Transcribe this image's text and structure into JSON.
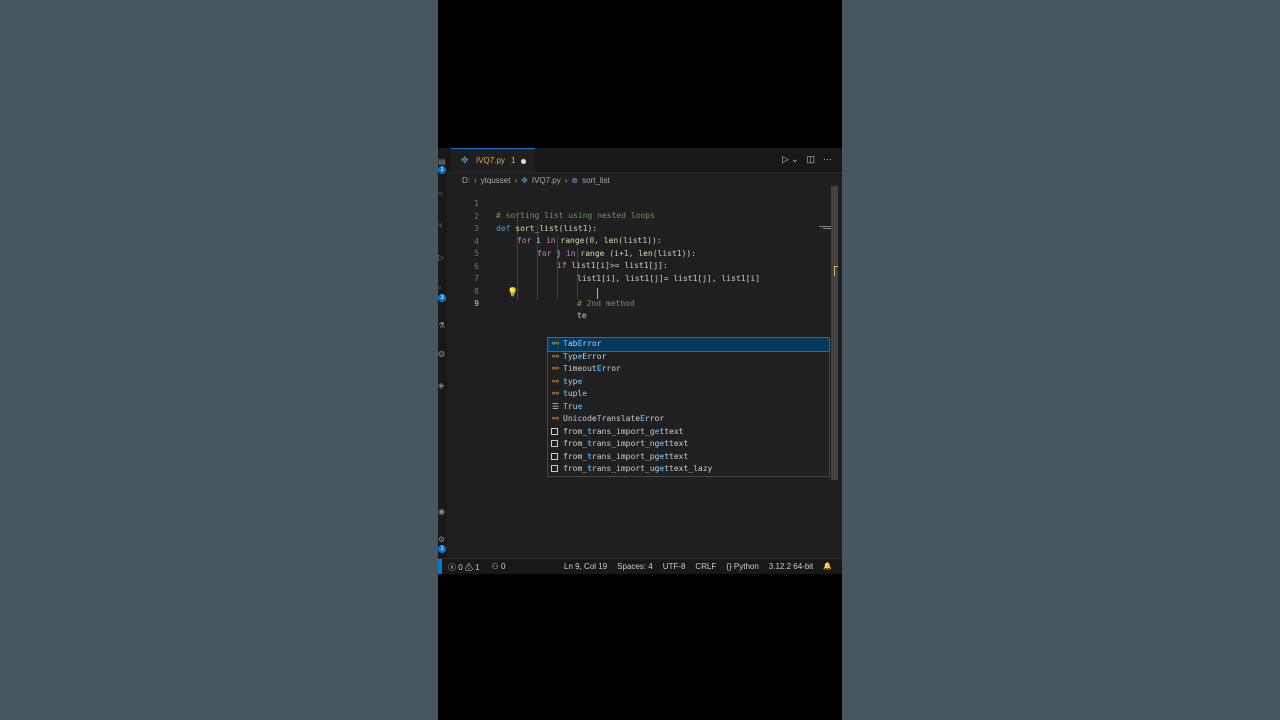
{
  "tab": {
    "filename": "IVQ7.py",
    "problems": "1",
    "file_icon": "python-file-icon"
  },
  "toolbar": {
    "run_icon": "▷",
    "dropdown_icon": "⌄",
    "split_icon": "◫",
    "more_icon": "···"
  },
  "breadcrumb": {
    "drive": "D:",
    "folder": "ytqusset",
    "file": "IVQ7.py",
    "symbol": "sort_list",
    "sep": "›"
  },
  "editor": {
    "line_numbers": [
      "1",
      "2",
      "3",
      "4",
      "5",
      "6",
      "7",
      "8",
      "9"
    ],
    "code_line_1": "# sorting list using nested loops",
    "kw_def": "def",
    "fn_name": "sort_list",
    "l2_args": "(list1):",
    "kw_for": "for",
    "kw_in": "in",
    "var_i": "i",
    "var_j": "j",
    "fn_range": "range",
    "fn_len": "len",
    "l3_mid": "(",
    "num_0": "0",
    "l3_rest": ", ",
    "l3_end": "(list1)):",
    "l4_mid": " (i+",
    "num_1": "1",
    "l4_rest": ", ",
    "l4_end": "(list1)):",
    "kw_if": "if",
    "l5_rest": " list1[i]>= list1[j]:",
    "code_line_6": "list1[i], list1[j]= list1[j], list1[i]",
    "code_line_8": "# 2nd method",
    "code_line_9": "te"
  },
  "suggestions": [
    {
      "pre": "",
      "hl": "T",
      "mid": "ab",
      "hl2": "E",
      "post": "rror",
      "icon": "class-icon",
      "glyph": "⚯"
    },
    {
      "pre": "",
      "hl": "T",
      "mid": "yp",
      "hl2": "e",
      "post": "Error",
      "icon": "class-icon",
      "glyph": "⚯"
    },
    {
      "pre": "",
      "hl": "T",
      "mid": "imeout",
      "hl2": "E",
      "post": "rror",
      "icon": "class-icon",
      "glyph": "⚯"
    },
    {
      "pre": "",
      "hl": "t",
      "mid": "yp",
      "hl2": "e",
      "post": "",
      "icon": "class-icon",
      "glyph": "⚯"
    },
    {
      "pre": "",
      "hl": "t",
      "mid": "upl",
      "hl2": "e",
      "post": "",
      "icon": "class-icon",
      "glyph": "⚯"
    },
    {
      "pre": "",
      "hl": "T",
      "mid": "ru",
      "hl2": "e",
      "post": "",
      "icon": "keyword-icon",
      "glyph": "☰"
    },
    {
      "pre": "Unicode",
      "hl": "T",
      "mid": "ranslate",
      "hl2": "E",
      "post": "rror",
      "icon": "class-icon",
      "glyph": "⚯"
    },
    {
      "pre": "from_",
      "hl": "t",
      "mid": "rans_import_g",
      "hl2": "e",
      "post": "ttext",
      "icon": "snippet-icon",
      "glyph": ""
    },
    {
      "pre": "from_",
      "hl": "t",
      "mid": "rans_import_ng",
      "hl2": "e",
      "post": "ttext",
      "icon": "snippet-icon",
      "glyph": ""
    },
    {
      "pre": "from_",
      "hl": "t",
      "mid": "rans_import_pg",
      "hl2": "e",
      "post": "ttext",
      "icon": "snippet-icon",
      "glyph": ""
    },
    {
      "pre": "from_",
      "hl": "t",
      "mid": "rans_import_ug",
      "hl2": "e",
      "post": "ttext_lazy",
      "icon": "snippet-icon",
      "glyph": ""
    }
  ],
  "status": {
    "errors": "0",
    "warnings": "1",
    "ports": "0",
    "error_glyph": "ⓧ",
    "warning_glyph": "⚠",
    "ports_glyph": "⚇",
    "position": "Ln 9, Col 19",
    "spaces": "Spaces: 4",
    "encoding": "UTF-8",
    "eol": "CRLF",
    "language": "Python",
    "lang_glyph": "{}",
    "interpreter": "3.12.2 64-bit",
    "bell_glyph": "🔔"
  },
  "colors": {
    "accent": "#0078d4",
    "comment": "#6a9955",
    "keyword": "#569cd6",
    "function": "#dcdcaa",
    "modified": "#d8b25a"
  }
}
